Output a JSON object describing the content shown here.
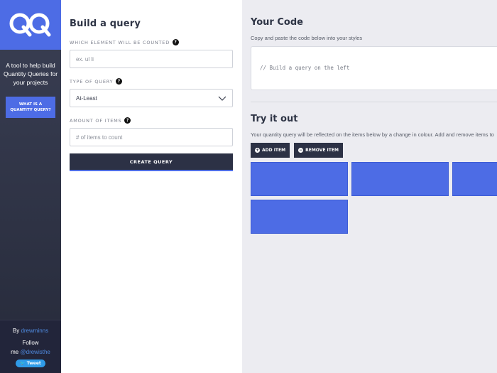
{
  "sidebar": {
    "logo": "QQ",
    "tagline": "A tool to help build Quantity Queries for your projects",
    "what_button": "WHAT IS A QUANTITY QUERY?",
    "by_label": "By",
    "by_link": "drewminns",
    "follow_label": "Follow",
    "follow_me": "me",
    "follow_link": "@drewisthe",
    "tweet_label": "Tweet"
  },
  "builder": {
    "title": "Build a query",
    "element_label": "WHICH ELEMENT WILL BE COUNTED",
    "element_placeholder": "ex. ul li",
    "type_label": "TYPE OF QUERY",
    "type_value": "At-Least",
    "amount_label": "AMOUNT OF ITEMS",
    "amount_placeholder": "# of items to count",
    "create_button": "CREATE QUERY"
  },
  "code": {
    "title": "Your Code",
    "note": "Copy and paste the code below into your styles",
    "content": "// Build a query on the left"
  },
  "try": {
    "title": "Try it out",
    "note": "Your quantity query will be reflected on the items below by a change in colour. Add and remove items to",
    "add_button": "ADD ITEM",
    "remove_button": "REMOVE ITEM",
    "item_count": 4
  },
  "colors": {
    "accent": "#4d6ce5",
    "dark": "#2c3145",
    "sidebar": "#303447"
  }
}
